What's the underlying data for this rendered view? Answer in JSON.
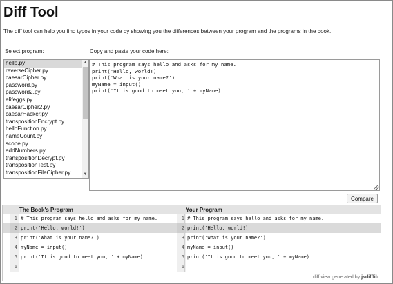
{
  "page": {
    "title": "Diff Tool",
    "intro": "The diff tool can help you find typos in your code by showing you the differences between your program and the programs in the book.",
    "select_label": "Select program:",
    "paste_label": "Copy and paste your code here:",
    "compare_label": "Compare"
  },
  "programs": {
    "items": [
      "hello.py",
      "reverseCipher.py",
      "caesarCipher.py",
      "password.py",
      "password2.py",
      "elifeggs.py",
      "caesarCipher2.py",
      "caesarHacker.py",
      "transpositionEncrypt.py",
      "helloFunction.py",
      "nameCount.py",
      "scope.py",
      "addNumbers.py",
      "transpositionDecrypt.py",
      "transpositionTest.py",
      "transpositionFileCipher.py"
    ],
    "selected": "hello.py"
  },
  "code_input": {
    "value": "# This program says hello and asks for my name.\nprint('Hello, world!)\nprint('What is your name?')\nmyName = input()\nprint('It is good to meet you, ' + myName)"
  },
  "diff": {
    "left_title": "The Book's Program",
    "right_title": "Your Program",
    "left_lines": [
      "# This program says hello and asks for my name.",
      "print('Hello, world!')",
      "print('What is your name?')",
      "myName = input()",
      "print('It is good to meet you, ' + myName)",
      ""
    ],
    "right_lines": [
      "# This program says hello and asks for my name.",
      "print('Hello, world!)",
      "print('What is your name?')",
      "myName = input()",
      "print('It is good to meet you, ' + myName)",
      ""
    ],
    "line_numbers": [
      "1",
      "2",
      "3",
      "4",
      "5",
      "6"
    ],
    "changed_line": 2,
    "footer_prefix": "diff view generated by",
    "footer_tool": "jsdifflib"
  }
}
